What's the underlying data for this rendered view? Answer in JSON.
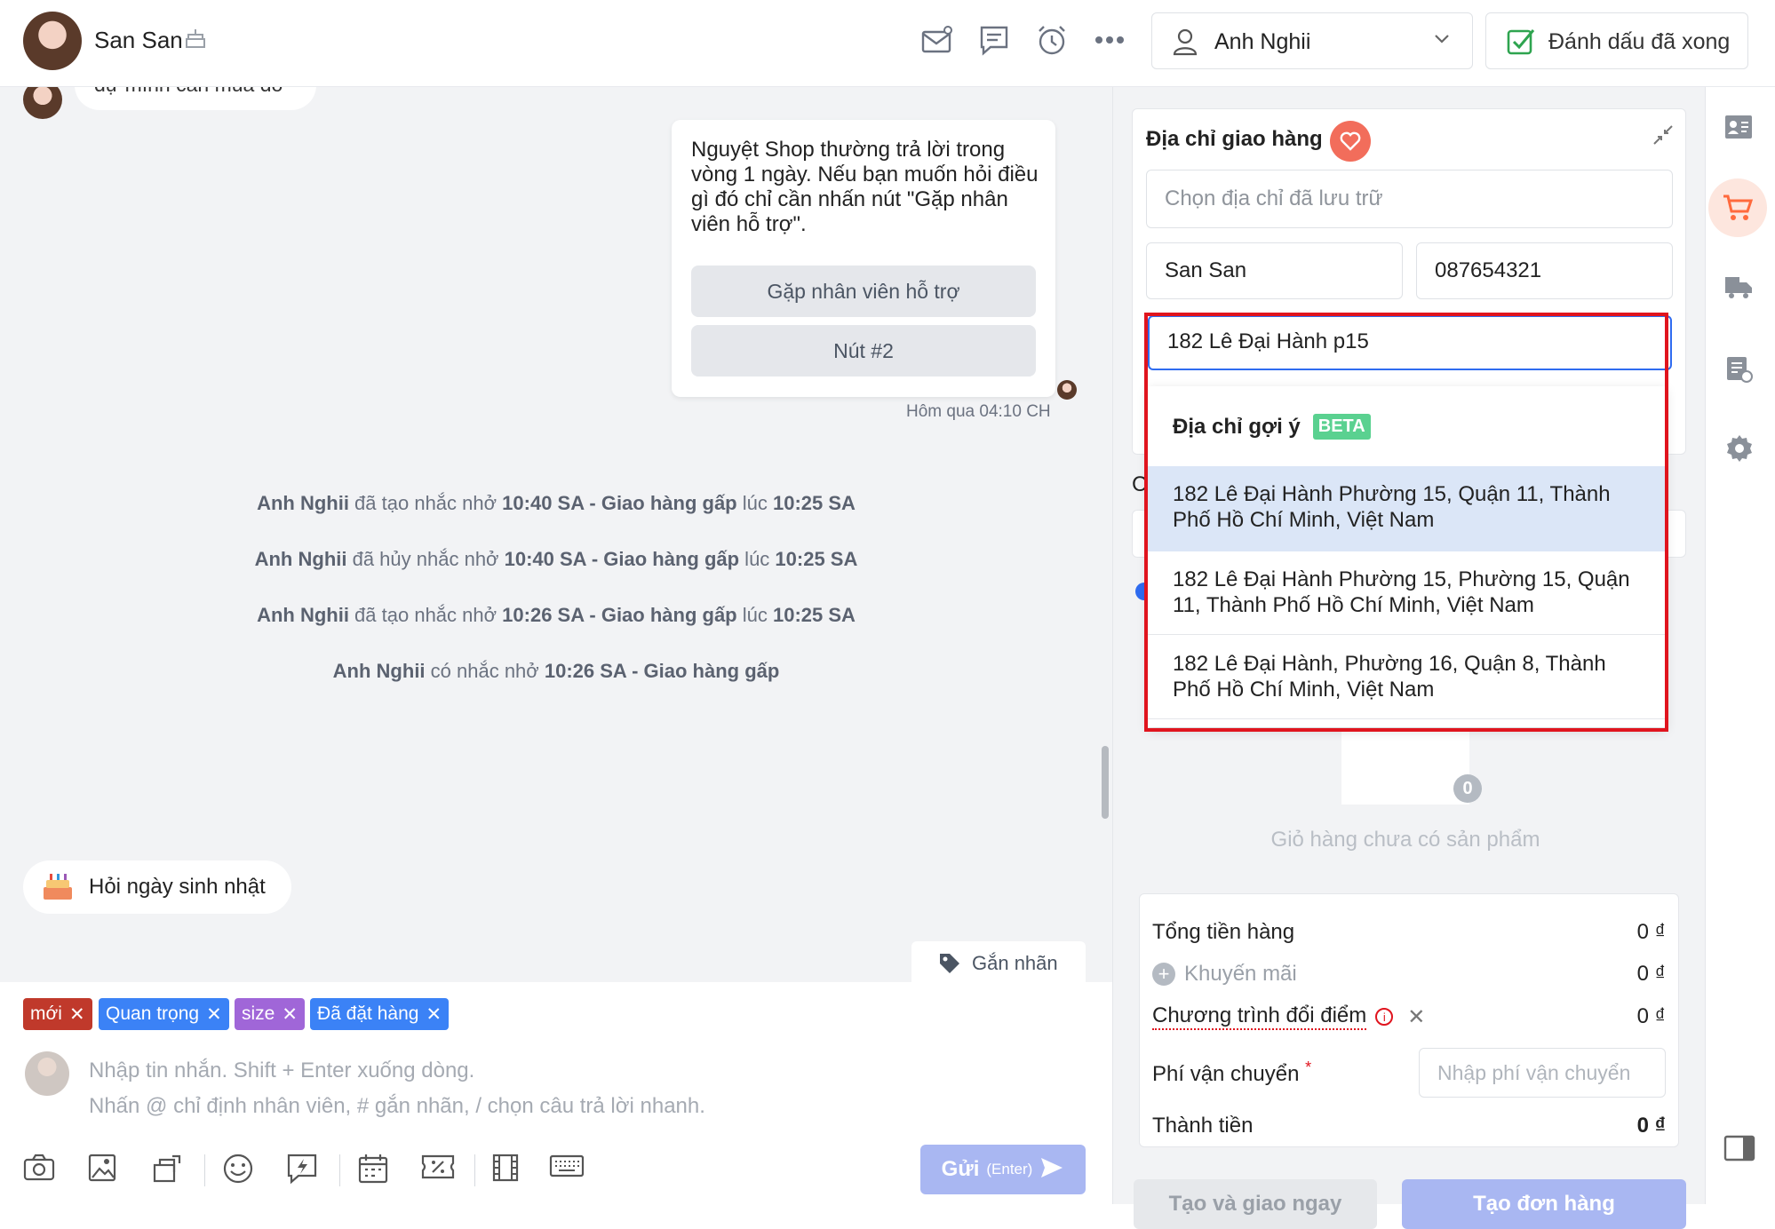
{
  "header": {
    "contact_name": "San San",
    "assignee": "Anh Nghii",
    "mark_done_label": "Đánh dấu đã xong"
  },
  "chat": {
    "partial_message": "dự mình cần mua đó",
    "bot_message": "Nguyệt Shop thường trả lời trong vòng 1 ngày. Nếu bạn muốn hỏi điều gì đó chỉ cần nhấn nút \"Gặp nhân viên hỗ trợ\".",
    "bot_buttons": [
      "Gặp nhân viên hỗ trợ",
      "Nút #2"
    ],
    "bot_time": "Hôm qua 04:10 CH",
    "system_events": [
      {
        "who": "Anh Nghii",
        "action": " đã tạo nhắc nhở ",
        "time": "10:40 SA",
        "title": " - Giao hàng gấp",
        "suffix": " lúc ",
        "at": "10:25 SA"
      },
      {
        "who": "Anh Nghii",
        "action": " đã hủy nhắc nhở ",
        "time": "10:40 SA",
        "title": " - Giao hàng gấp",
        "suffix": " lúc ",
        "at": "10:25 SA"
      },
      {
        "who": "Anh Nghii",
        "action": " đã tạo nhắc nhở ",
        "time": "10:26 SA",
        "title": " - Giao hàng gấp",
        "suffix": " lúc ",
        "at": "10:25 SA"
      },
      {
        "who": "Anh Nghii",
        "action": " có nhắc nhở ",
        "time": "10:26 SA",
        "title": " - Giao hàng gấp",
        "suffix": "",
        "at": ""
      }
    ],
    "birthday_chip": "Hỏi ngày sinh nhật",
    "label_button": "Gắn nhãn"
  },
  "composer": {
    "tags": [
      {
        "label": "mới",
        "color": "#c0392b"
      },
      {
        "label": "Quan trọng",
        "color": "#3b82f6"
      },
      {
        "label": "size",
        "color": "#a066d8"
      },
      {
        "label": "Đã đặt hàng",
        "color": "#3b82f6"
      }
    ],
    "placeholder_line1": "Nhập tin nhắn. Shift + Enter xuống dòng.",
    "placeholder_line2": "Nhấn @ chỉ định nhân viên, # gắn nhãn, / chọn câu trả lời nhanh.",
    "send_label": "Gửi",
    "send_hint": "(Enter)"
  },
  "order": {
    "section_title": "Địa chỉ giao hàng",
    "saved_address_placeholder": "Chọn địa chỉ đã lưu trữ",
    "name_value": "San San",
    "phone_value": "087654321",
    "address_value": "182 Lê Đại Hành p15",
    "suggest_title": "Địa chỉ gợi ý",
    "suggest_badge": "BETA",
    "suggestions": [
      "182 Lê Đại Hành Phường 15, Quận 11, Thành Phố Hồ Chí Minh, Việt Nam",
      "182 Lê Đại Hành Phường 15, Phường 15, Quận 11, Thành Phố Hồ Chí Minh, Việt Nam",
      "182 Lê Đại Hành, Phường 16, Quận 8, Thành Phố Hồ Chí Minh, Việt Nam"
    ],
    "cart_count": "0",
    "cart_empty": "Giỏ hàng chưa có sản phẩm",
    "summary": {
      "subtotal_label": "Tổng tiền hàng",
      "subtotal_value": "0 ₫",
      "promo_label": "Khuyến mãi",
      "promo_value": "0 ₫",
      "points_label": "Chương trình đổi điểm",
      "points_value": "0 ₫",
      "shipping_label": "Phí vận chuyển",
      "shipping_required": "*",
      "shipping_placeholder": "Nhập phí vận chuyển",
      "total_label": "Thành tiền",
      "total_value": "0 ₫"
    },
    "bottom_buttons": [
      "Tạo và giao ngay",
      "Tạo đơn hàng"
    ]
  },
  "colors": {
    "accent": "#ff6a3d",
    "highlight": "#dbe6f7",
    "outline": "#e0141e",
    "beta": "#5ad190"
  }
}
